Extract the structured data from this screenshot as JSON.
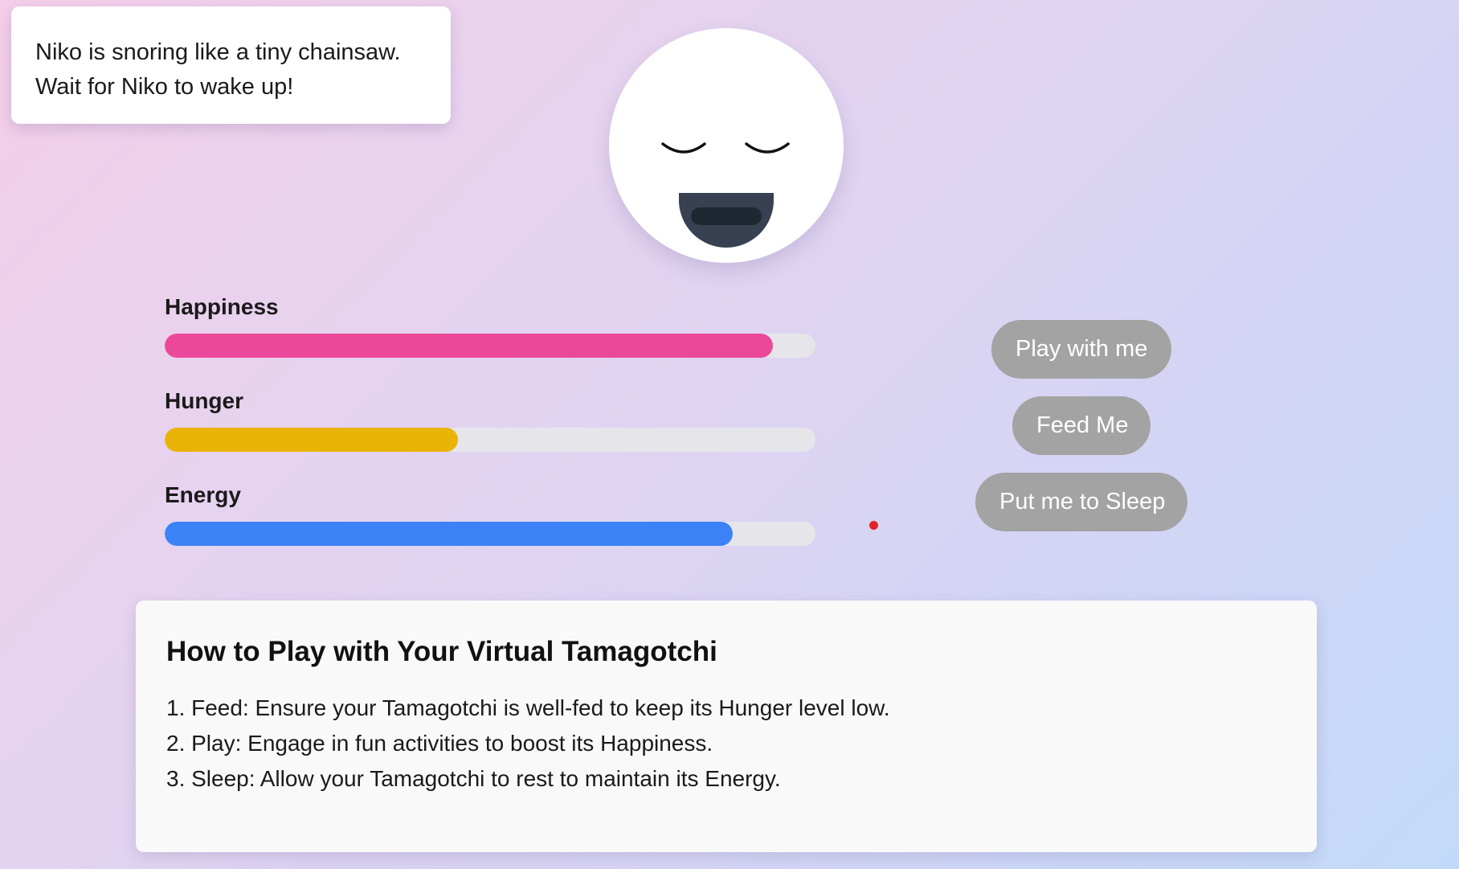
{
  "toast": {
    "line1": "Niko is snoring like a tiny chainsaw.",
    "line2": "Wait for Niko to wake up!"
  },
  "pet": {
    "name": "Niko",
    "state": "sleeping"
  },
  "stats": [
    {
      "label": "Happiness",
      "value": 0.935,
      "color": "#ec4899"
    },
    {
      "label": "Hunger",
      "value": 0.45,
      "color": "#eab308"
    },
    {
      "label": "Energy",
      "value": 0.873,
      "color": "#3b82f6"
    }
  ],
  "actions": {
    "play_label": "Play with me",
    "feed_label": "Feed Me",
    "sleep_label": "Put me to Sleep",
    "disabled_color": "#a3a3a3"
  },
  "instructions": {
    "title": "How to Play with Your Virtual Tamagotchi",
    "items": [
      "1. Feed: Ensure your Tamagotchi is well-fed to keep its Hunger level low.",
      "2. Play: Engage in fun activities to boost its Happiness.",
      "3. Sleep: Allow your Tamagotchi to rest to maintain its Energy."
    ]
  }
}
